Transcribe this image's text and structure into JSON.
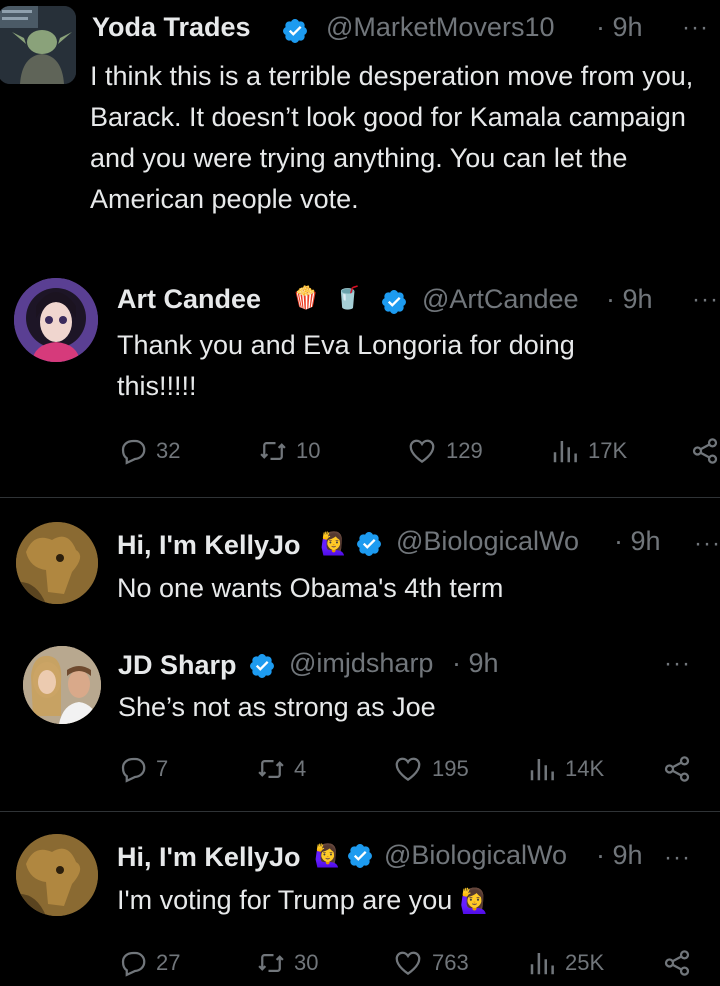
{
  "tweets": [
    {
      "name": "Yoda Trades",
      "handle": "@MarketMovers10",
      "time": "· 9h",
      "text": "I think this is a terrible desperation move from you, Barack. It doesn’t look good for Kamala campaign and you were trying anything. You can let the American people vote."
    },
    {
      "name": "Art Candee",
      "handle": "@ArtCandee",
      "time": "· 9h",
      "text": "Thank you and Eva Longoria for doing this!!!!!",
      "emojis": [
        "🍿",
        "🥤"
      ],
      "actions": {
        "replies": "32",
        "reposts": "10",
        "likes": "129",
        "views": "17K"
      }
    },
    {
      "name": "Hi, I'm KellyJo",
      "handle": "@BiologicalWo",
      "time": "· 9h",
      "text": "No one wants Obama's 4th term",
      "emoji": "🙋‍♀️"
    },
    {
      "name": "JD Sharp",
      "handle": "@imjdsharp",
      "time": "· 9h",
      "text": "She’s not as strong as Joe",
      "actions": {
        "replies": "7",
        "reposts": "4",
        "likes": "195",
        "views": "14K"
      }
    },
    {
      "name": "Hi, I'm KellyJo",
      "handle": "@BiologicalWo",
      "time": "· 9h",
      "text": "I'm voting for Trump are you",
      "emoji": "🙋‍♀️",
      "text_emoji": "🙋‍♀️",
      "actions": {
        "replies": "27",
        "reposts": "30",
        "likes": "763",
        "views": "25K"
      }
    }
  ],
  "more_glyph": "···",
  "colors": {
    "background": "#000000",
    "text": "#e7e9ea",
    "muted": "#71767b",
    "verified": "#1d9bf0",
    "divider": "#2f3336"
  }
}
